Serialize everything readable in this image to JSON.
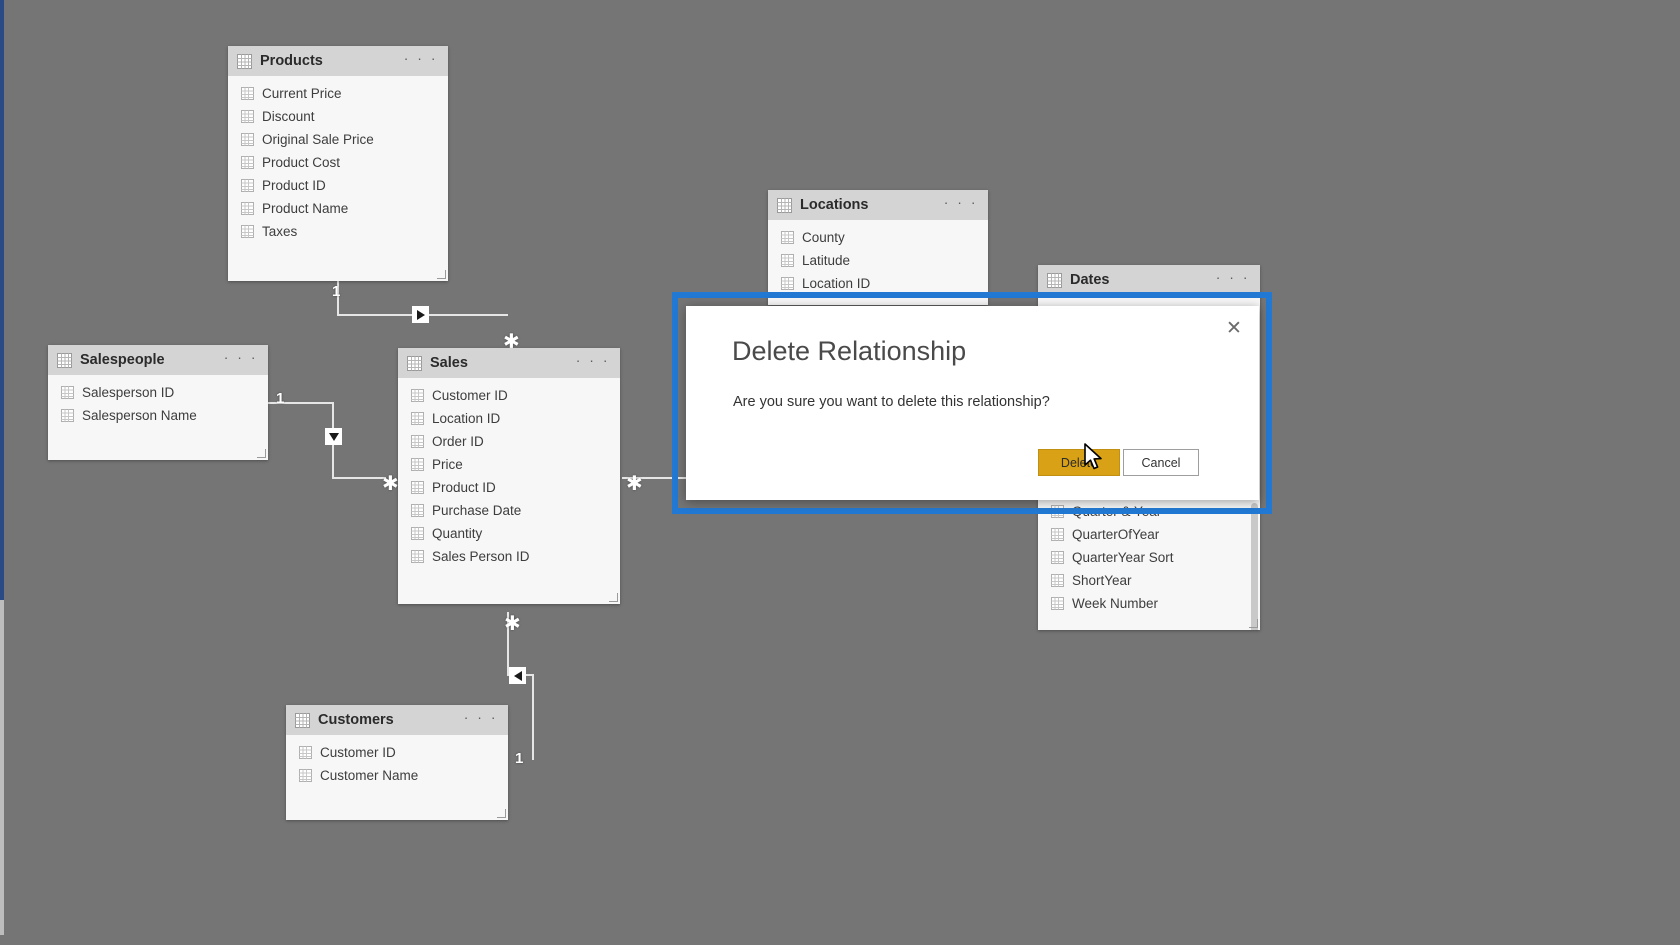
{
  "canvas": {
    "background": "#757575",
    "accent_blue": "#2279d4",
    "card_header": "#d4d4d4",
    "card_body": "#f7f7f7"
  },
  "tables": [
    {
      "name": "Products",
      "menu": "· · ·",
      "fields": [
        "Current Price",
        "Discount",
        "Original Sale Price",
        "Product Cost",
        "Product ID",
        "Product Name",
        "Taxes"
      ]
    },
    {
      "name": "Locations",
      "menu": "· · ·",
      "fields": [
        "County",
        "Latitude",
        "Location ID"
      ]
    },
    {
      "name": "Dates",
      "menu": "· · ·",
      "fields": [
        "Quarter & Year",
        "QuarterOfYear",
        "QuarterYear Sort",
        "ShortYear",
        "Week Number"
      ]
    },
    {
      "name": "Salespeople",
      "menu": "· · ·",
      "fields": [
        "Salesperson ID",
        "Salesperson Name"
      ]
    },
    {
      "name": "Sales",
      "menu": "· · ·",
      "fields": [
        "Customer ID",
        "Location ID",
        "Order ID",
        "Price",
        "Product ID",
        "Purchase Date",
        "Quantity",
        "Sales Person ID"
      ]
    },
    {
      "name": "Customers",
      "menu": "· · ·",
      "fields": [
        "Customer ID",
        "Customer Name"
      ]
    }
  ],
  "relationships": {
    "one_label": "1",
    "many_label": "✱",
    "items": [
      {
        "from": "Products",
        "to": "Sales",
        "cardinality_one": "1",
        "cardinality_many": "✱",
        "direction": "right"
      },
      {
        "from": "Salespeople",
        "to": "Sales",
        "cardinality_one": "1",
        "cardinality_many": "✱",
        "direction": "down"
      },
      {
        "from": "Sales",
        "to": "Dates",
        "cardinality_one": "1",
        "cardinality_many": "✱",
        "direction": "right"
      },
      {
        "from": "Customers",
        "to": "Sales",
        "cardinality_one": "1",
        "cardinality_many": "✱",
        "direction": "left"
      }
    ]
  },
  "dialog": {
    "title": "Delete Relationship",
    "message": "Are you sure you want to delete this relationship?",
    "delete_label": "Delete",
    "cancel_label": "Cancel",
    "close_label": "✕",
    "delete_color": "#d8a116",
    "focus_border_color": "#2279d4"
  }
}
